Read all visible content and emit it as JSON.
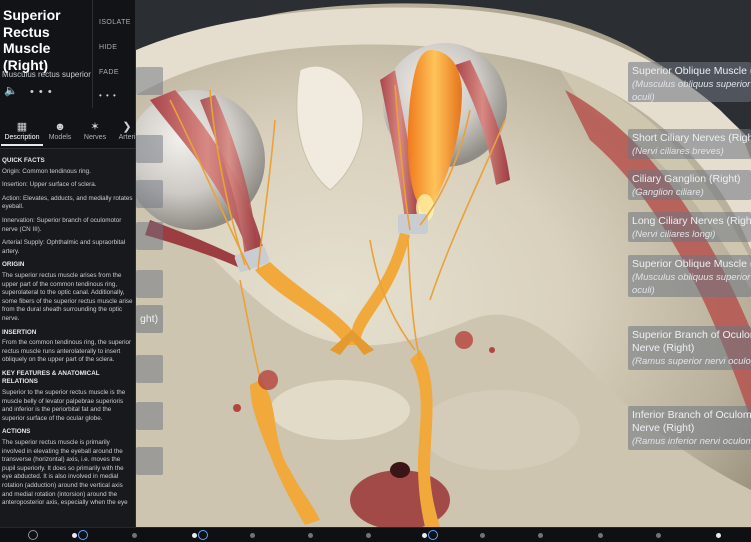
{
  "structure": {
    "title": "Superior Rectus Muscle (Right)",
    "latin": "Musculus rectus superior",
    "actions": [
      "ISOLATE",
      "HIDE",
      "FADE"
    ],
    "more_dots": "• • •",
    "speaker_glyph": "🔈"
  },
  "tabs": [
    {
      "label": "Description",
      "icon": "book-icon",
      "active": true
    },
    {
      "label": "Models",
      "icon": "models-icon",
      "active": false
    },
    {
      "label": "Nerves",
      "icon": "nerves-icon",
      "active": false
    },
    {
      "label": "Arteri",
      "icon": "arteries-icon",
      "active": false
    }
  ],
  "description": {
    "quick_facts_heading": "QUICK FACTS",
    "facts": [
      "Origin: Common tendinous ring.",
      "Insertion: Upper surface of sclera.",
      "Action: Elevates, adducts, and medially rotates eyeball.",
      "Innervation: Superior branch of oculomotor nerve (CN III).",
      "Arterial Supply: Ophthalmic and supraorbital artery."
    ],
    "origin_heading": "ORIGIN",
    "origin_text": "The superior rectus muscle arises from the upper part of the common tendinous ring, superolateral to the optic canal. Additionally, some fibers of the superior rectus muscle arise from the dural sheath surrounding the optic nerve.",
    "insertion_heading": "INSERTION",
    "insertion_text": "From the common tendinous ring, the superior rectus muscle runs anterolaterally to insert obliquely on the upper part of the sclera.",
    "key_heading": "KEY FEATURES & ANATOMICAL RELATIONS",
    "key_text": "Superior to the superior rectus muscle is the muscle belly of levator palpebrae superioris and inferior is the periorbital fat and the superior surface of the ocular globe.",
    "actions_heading": "ACTIONS",
    "actions_text": "The superior rectus muscle is primarily involved in elevating the eyeball around the transverse (horizontal) axis, i.e. moves the pupil superiorly. It does so primarily with the eye abducted. It is also involved in medial rotation (adduction) around the vertical axis and medial rotation (intorsion) around the anteroposterior axis, especially when the eye"
  },
  "labels": [
    {
      "name": "Superior Oblique Muscle (Left)",
      "latin": "(Musculus obliquus superior bulbi oculi)",
      "line1": "Superior Oblique Muscle (L",
      "line2": "(Musculus obliquus superior bu",
      "line3": "oculi)"
    },
    {
      "name": "Short Ciliary Nerves (Right)",
      "line1": "Short Ciliary Nerves (Right",
      "line2": "(Nervi ciliares breves)"
    },
    {
      "name": "Ciliary Ganglion (Right)",
      "line1": "Ciliary Ganglion (Right)",
      "line2": "(Ganglion ciliare)"
    },
    {
      "name": "Long Ciliary Nerves (Right)",
      "line1": "Long Ciliary Nerves (Right",
      "line2": "(Nervi ciliares longi)"
    },
    {
      "name": "Superior Oblique Muscle (Right)",
      "line1": "Superior Oblique Muscle (R",
      "line2": "(Musculus obliquus superior bu",
      "line3": "oculi)"
    },
    {
      "name": "Superior Branch of Oculomotor Nerve (Right)",
      "line1": "Superior Branch of Oculom",
      "line2": "Nerve (Right)",
      "line3": "(Ramus superior nervi oculomo"
    },
    {
      "name": "Inferior Branch of Oculomotor Nerve (Right)",
      "line1": "Inferior Branch of Oculomo",
      "line2": "Nerve (Right)",
      "line3": "(Ramus inferior nervi oculomo"
    }
  ],
  "fragment_label": "ght)",
  "colors": {
    "nerve": "#f0a93a",
    "muscle": "#c7696a",
    "highlight": "#f7a23a",
    "bone": "#ddd6c3",
    "sidebar": "#17191d"
  }
}
